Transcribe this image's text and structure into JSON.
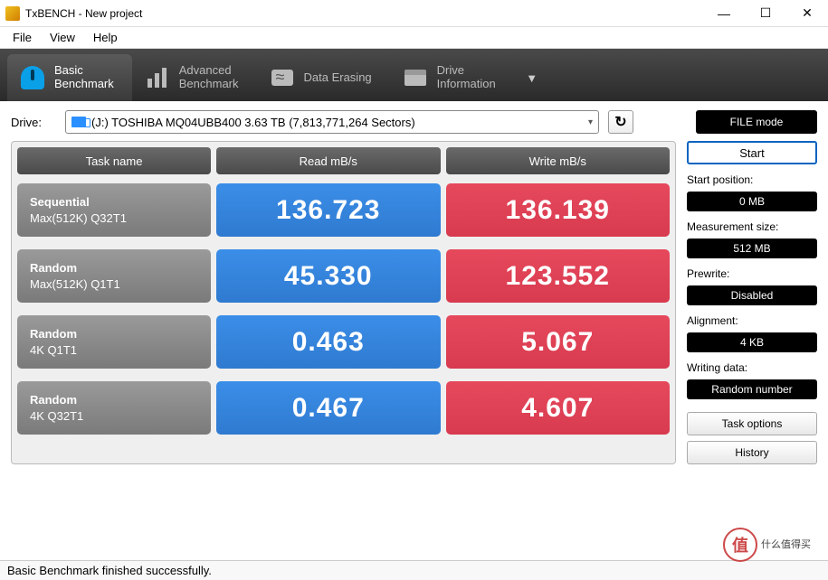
{
  "window": {
    "title": "TxBENCH - New project"
  },
  "menu": {
    "file": "File",
    "view": "View",
    "help": "Help"
  },
  "tabs": {
    "basic": "Basic\nBenchmark",
    "advanced": "Advanced\nBenchmark",
    "erase": "Data Erasing",
    "drive": "Drive\nInformation"
  },
  "drive": {
    "label": "Drive:",
    "selected": "(J:) TOSHIBA MQ04UBB400  3.63 TB (7,813,771,264 Sectors)",
    "filemode": "FILE mode"
  },
  "headers": {
    "task": "Task name",
    "read": "Read mB/s",
    "write": "Write mB/s"
  },
  "rows": [
    {
      "name1": "Sequential",
      "name2": "Max(512K) Q32T1",
      "read": "136.723",
      "write": "136.139"
    },
    {
      "name1": "Random",
      "name2": "Max(512K) Q1T1",
      "read": "45.330",
      "write": "123.552"
    },
    {
      "name1": "Random",
      "name2": "4K Q1T1",
      "read": "0.463",
      "write": "5.067"
    },
    {
      "name1": "Random",
      "name2": "4K Q32T1",
      "read": "0.467",
      "write": "4.607"
    }
  ],
  "side": {
    "start": "Start",
    "startpos_label": "Start position:",
    "startpos": "0 MB",
    "meassize_label": "Measurement size:",
    "meassize": "512 MB",
    "prewrite_label": "Prewrite:",
    "prewrite": "Disabled",
    "align_label": "Alignment:",
    "align": "4 KB",
    "wdata_label": "Writing data:",
    "wdata": "Random number",
    "taskopts": "Task options",
    "history": "History"
  },
  "status": "Basic Benchmark finished successfully.",
  "watermark": "什么值得买",
  "chart_data": {
    "type": "table",
    "title": "TxBENCH Basic Benchmark",
    "columns": [
      "Task name",
      "Read mB/s",
      "Write mB/s"
    ],
    "categories": [
      "Sequential Max(512K) Q32T1",
      "Random Max(512K) Q1T1",
      "Random 4K Q1T1",
      "Random 4K Q32T1"
    ],
    "series": [
      {
        "name": "Read mB/s",
        "values": [
          136.723,
          45.33,
          0.463,
          0.467
        ]
      },
      {
        "name": "Write mB/s",
        "values": [
          136.139,
          123.552,
          5.067,
          4.607
        ]
      }
    ]
  }
}
